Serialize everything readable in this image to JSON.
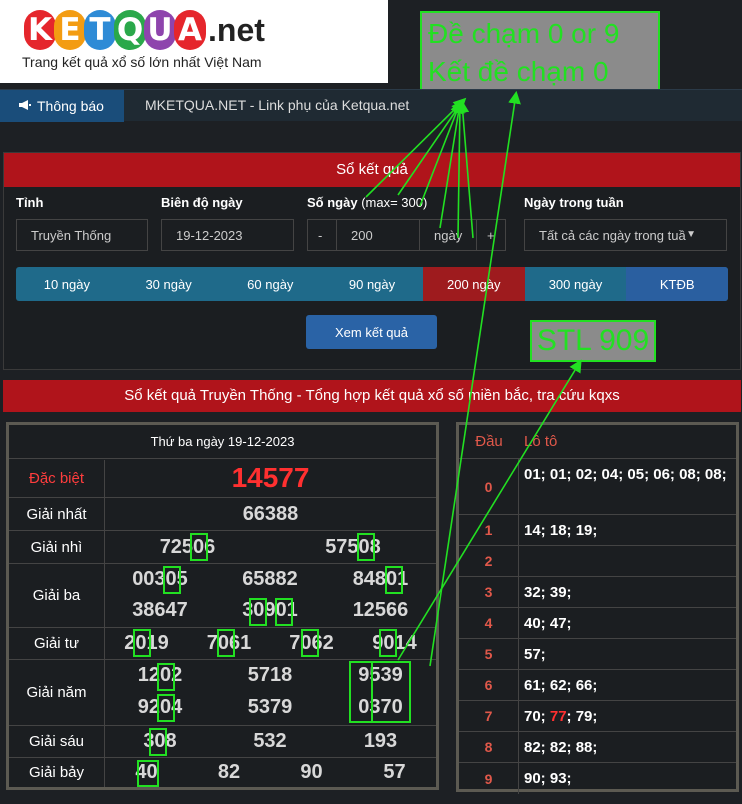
{
  "header": {
    "logo_letters": [
      "K",
      "E",
      "T",
      "Q",
      "U",
      "A"
    ],
    "logo_suffix": ".net",
    "tagline": "Trang kết quả xổ số lớn nhất Việt Nam",
    "logo_colors": [
      "#e5262c",
      "#f39c12",
      "#2e8bd6",
      "#2aa84a",
      "#8e44ad",
      "#e5262c"
    ]
  },
  "overlay": {
    "line1": "Đề chạm 0 or 9",
    "line2": "Kết đề chạm 0",
    "stl": "STL 909",
    "accent": "#22e022"
  },
  "notice": {
    "tab_label": "Thông báo",
    "text": "MKETQUA.NET - Link phụ của Ketqua.net"
  },
  "search": {
    "title": "Sổ kết quả",
    "province_label": "Tỉnh",
    "province_value": "Truyền Thống",
    "date_label": "Biên độ ngày",
    "date_value": "19-12-2023",
    "days_label": "Số ngày",
    "days_hint": "(max= 300)",
    "days_value": "200",
    "days_unit": "ngày",
    "minus": "-",
    "plus": "+",
    "weekday_label": "Ngày trong tuần",
    "weekday_value": "Tất cả các ngày trong tuầ",
    "ranges": [
      "10 ngày",
      "30 ngày",
      "60 ngày",
      "90 ngày",
      "200 ngày",
      "300 ngày",
      "KTĐB"
    ],
    "view_button": "Xem kết quả"
  },
  "section_title": "Sổ kết quả Truyền Thống - Tổng hợp kết quả xổ số miền bắc, tra cứu kqxs",
  "results": {
    "date": "Thứ ba ngày 19-12-2023",
    "labels": {
      "special": "Đặc biệt",
      "first": "Giải nhất",
      "second": "Giải nhì",
      "third": "Giải ba",
      "fourth": "Giải tư",
      "fifth": "Giải năm",
      "sixth": "Giải sáu",
      "seventh": "Giải bảy"
    },
    "special": "14577",
    "first": "66388",
    "second": [
      "72506",
      "57508"
    ],
    "third": [
      "00305",
      "65882",
      "84801",
      "38647",
      "30901",
      "12566"
    ],
    "fourth": [
      "2019",
      "7061",
      "7062",
      "9014"
    ],
    "fifth": [
      "1202",
      "5718",
      "9539",
      "9204",
      "5379",
      "0370"
    ],
    "sixth": [
      "308",
      "532",
      "193"
    ],
    "seventh": [
      "40",
      "82",
      "90",
      "57"
    ]
  },
  "loto": {
    "head_col": "Đầu",
    "value_col": "Lô tô",
    "rows": [
      {
        "d": "0",
        "v": "01; 01; 02; 04; 05; 06; 08; 08;"
      },
      {
        "d": "1",
        "v": "14; 18; 19;"
      },
      {
        "d": "2",
        "v": ""
      },
      {
        "d": "3",
        "v": "32; 39;"
      },
      {
        "d": "4",
        "v": "40; 47;"
      },
      {
        "d": "5",
        "v": "57;"
      },
      {
        "d": "6",
        "v": "61; 62; 66;"
      },
      {
        "d": "7",
        "v_pre": "70; ",
        "v_red": "77",
        "v_post": "; 79;"
      },
      {
        "d": "8",
        "v": "82; 82; 88;"
      },
      {
        "d": "9",
        "v": "90; 93;"
      }
    ]
  }
}
